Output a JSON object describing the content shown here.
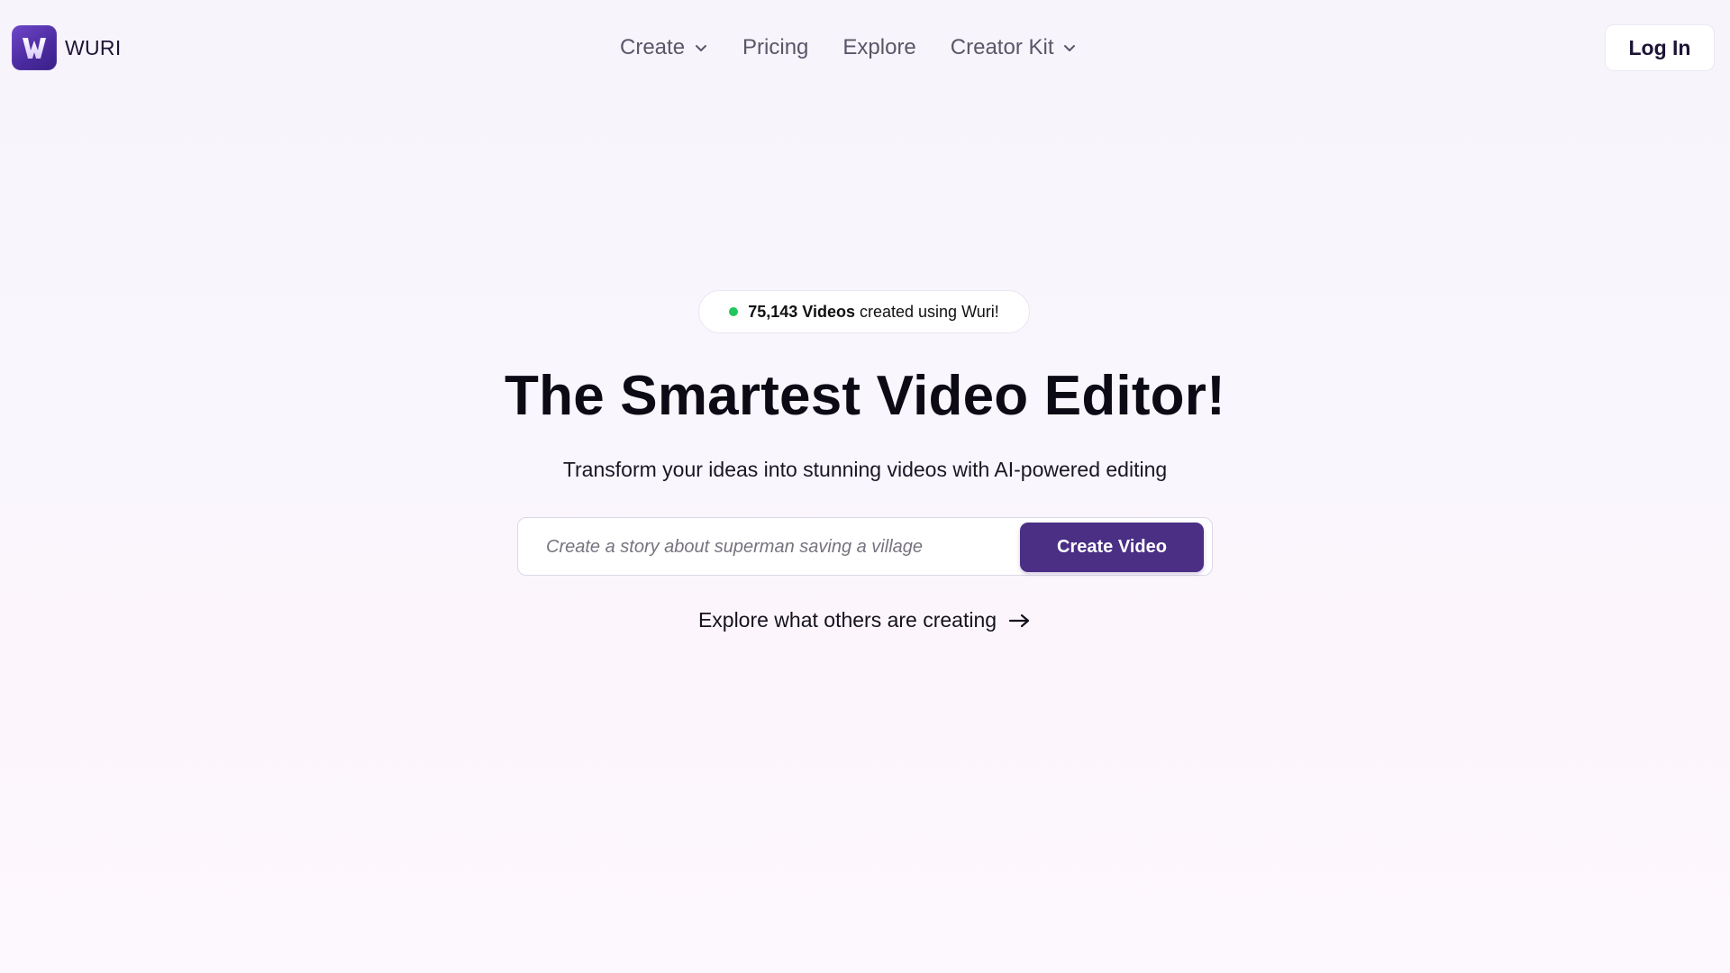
{
  "brand": {
    "name": "WURI",
    "logo_letter": "W",
    "logo_color": "#4a2a9e"
  },
  "nav": {
    "items": [
      {
        "label": "Create",
        "has_dropdown": true
      },
      {
        "label": "Pricing",
        "has_dropdown": false
      },
      {
        "label": "Explore",
        "has_dropdown": false
      },
      {
        "label": "Creator Kit",
        "has_dropdown": true
      }
    ]
  },
  "header": {
    "login_label": "Log In"
  },
  "hero": {
    "badge": {
      "count": "75,143 Videos",
      "text": "created using Wuri!",
      "dot_color": "#22c55e"
    },
    "title": "The Smartest Video Editor!",
    "subtitle": "Transform your ideas into stunning videos with AI-powered editing",
    "prompt": {
      "value": "",
      "placeholder": "Create a story about superman saving a village",
      "button_label": "Create Video",
      "button_color": "#4a2f85"
    },
    "explore_link": "Explore what others are creating"
  },
  "icons": {
    "dropdown": "chevron-down-icon",
    "explore": "arrow-right-icon"
  }
}
